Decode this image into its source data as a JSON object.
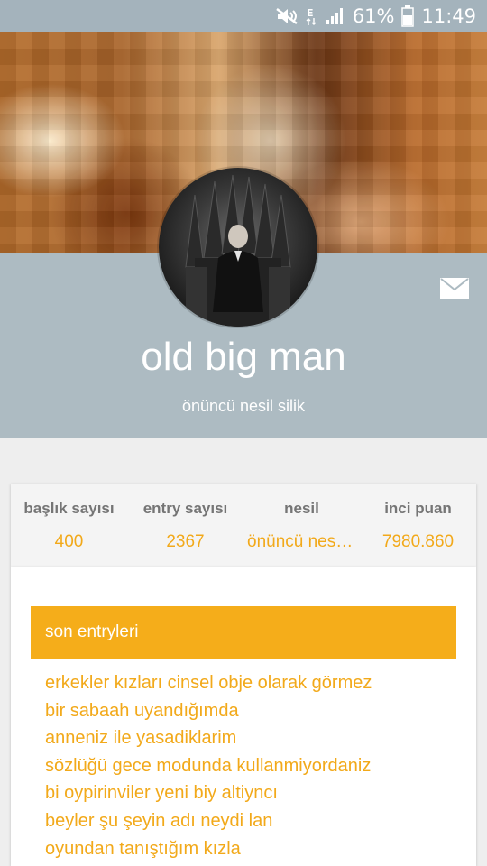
{
  "status_bar": {
    "battery": "61%",
    "time": "11:49",
    "icons": [
      "mute-icon",
      "data-e-icon",
      "signal-icon",
      "battery-icon"
    ]
  },
  "profile": {
    "name": "old big man",
    "subtitle": "önüncü nesil silik",
    "mail_icon": "mail-icon"
  },
  "stats": [
    {
      "label": "başlık sayısı",
      "value": "400"
    },
    {
      "label": "entry sayısı",
      "value": "2367"
    },
    {
      "label": "nesil",
      "value": "önüncü nesil silik"
    },
    {
      "label": "inci puan",
      "value": "7980.860"
    }
  ],
  "entries": {
    "title": "son entryleri",
    "items": [
      "erkekler kızları cinsel obje olarak görmez",
      "bir sabaah uyandığımda",
      "anneniz ile yasadiklarim",
      "sözlüğü gece modunda kullanmiyordaniz",
      "bi oypirinviler yeni biy altiyncı",
      "beyler şu şeyin adı neydi lan",
      "oyundan tanıştığım kızla"
    ]
  },
  "colors": {
    "accent": "#f5ad1a",
    "status_bar": "#a4b3bc",
    "profile_band": "#adbbc2"
  }
}
